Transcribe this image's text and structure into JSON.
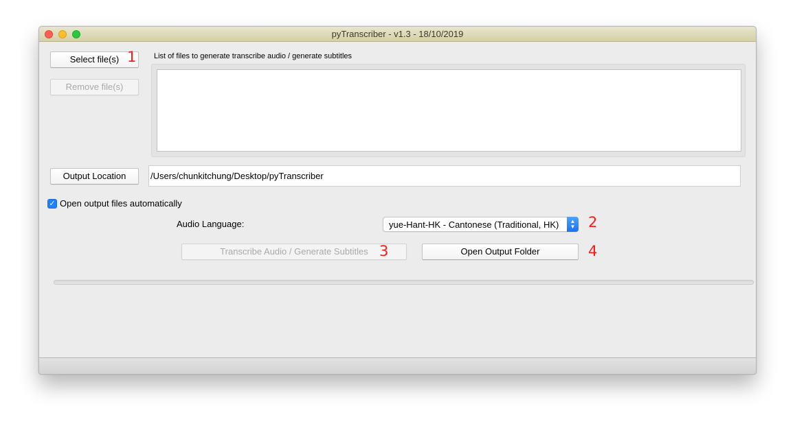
{
  "window": {
    "title": "pyTranscriber - v1.3 - 18/10/2019"
  },
  "buttons": {
    "select_files": "Select file(s)",
    "remove_files": "Remove file(s)",
    "output_location": "Output Location",
    "transcribe": "Transcribe Audio / Generate Subtitles",
    "open_output_folder": "Open Output Folder"
  },
  "annotations": {
    "one": "1",
    "two": "2",
    "three": "3",
    "four": "4"
  },
  "file_list": {
    "label": "List of files to generate transcribe audio / generate subtitles",
    "items": []
  },
  "output": {
    "path": "/Users/chunkitchung/Desktop/pyTranscriber"
  },
  "options": {
    "open_automatically_label": "Open output files automatically",
    "open_automatically_checked": true
  },
  "language": {
    "label": "Audio Language:",
    "selected": "yue-Hant-HK - Cantonese (Traditional, HK)"
  },
  "progress": {
    "value": 0
  },
  "colors": {
    "annotation": "#ff1a1a",
    "accent": "#1f7fff",
    "titlebar": "#dcd9b6"
  },
  "icons": {
    "close": "close-icon",
    "minimize": "minimize-icon",
    "maximize": "maximize-icon",
    "checkmark": "checkmark-icon",
    "select_arrows": "chevron-up-down-icon"
  }
}
